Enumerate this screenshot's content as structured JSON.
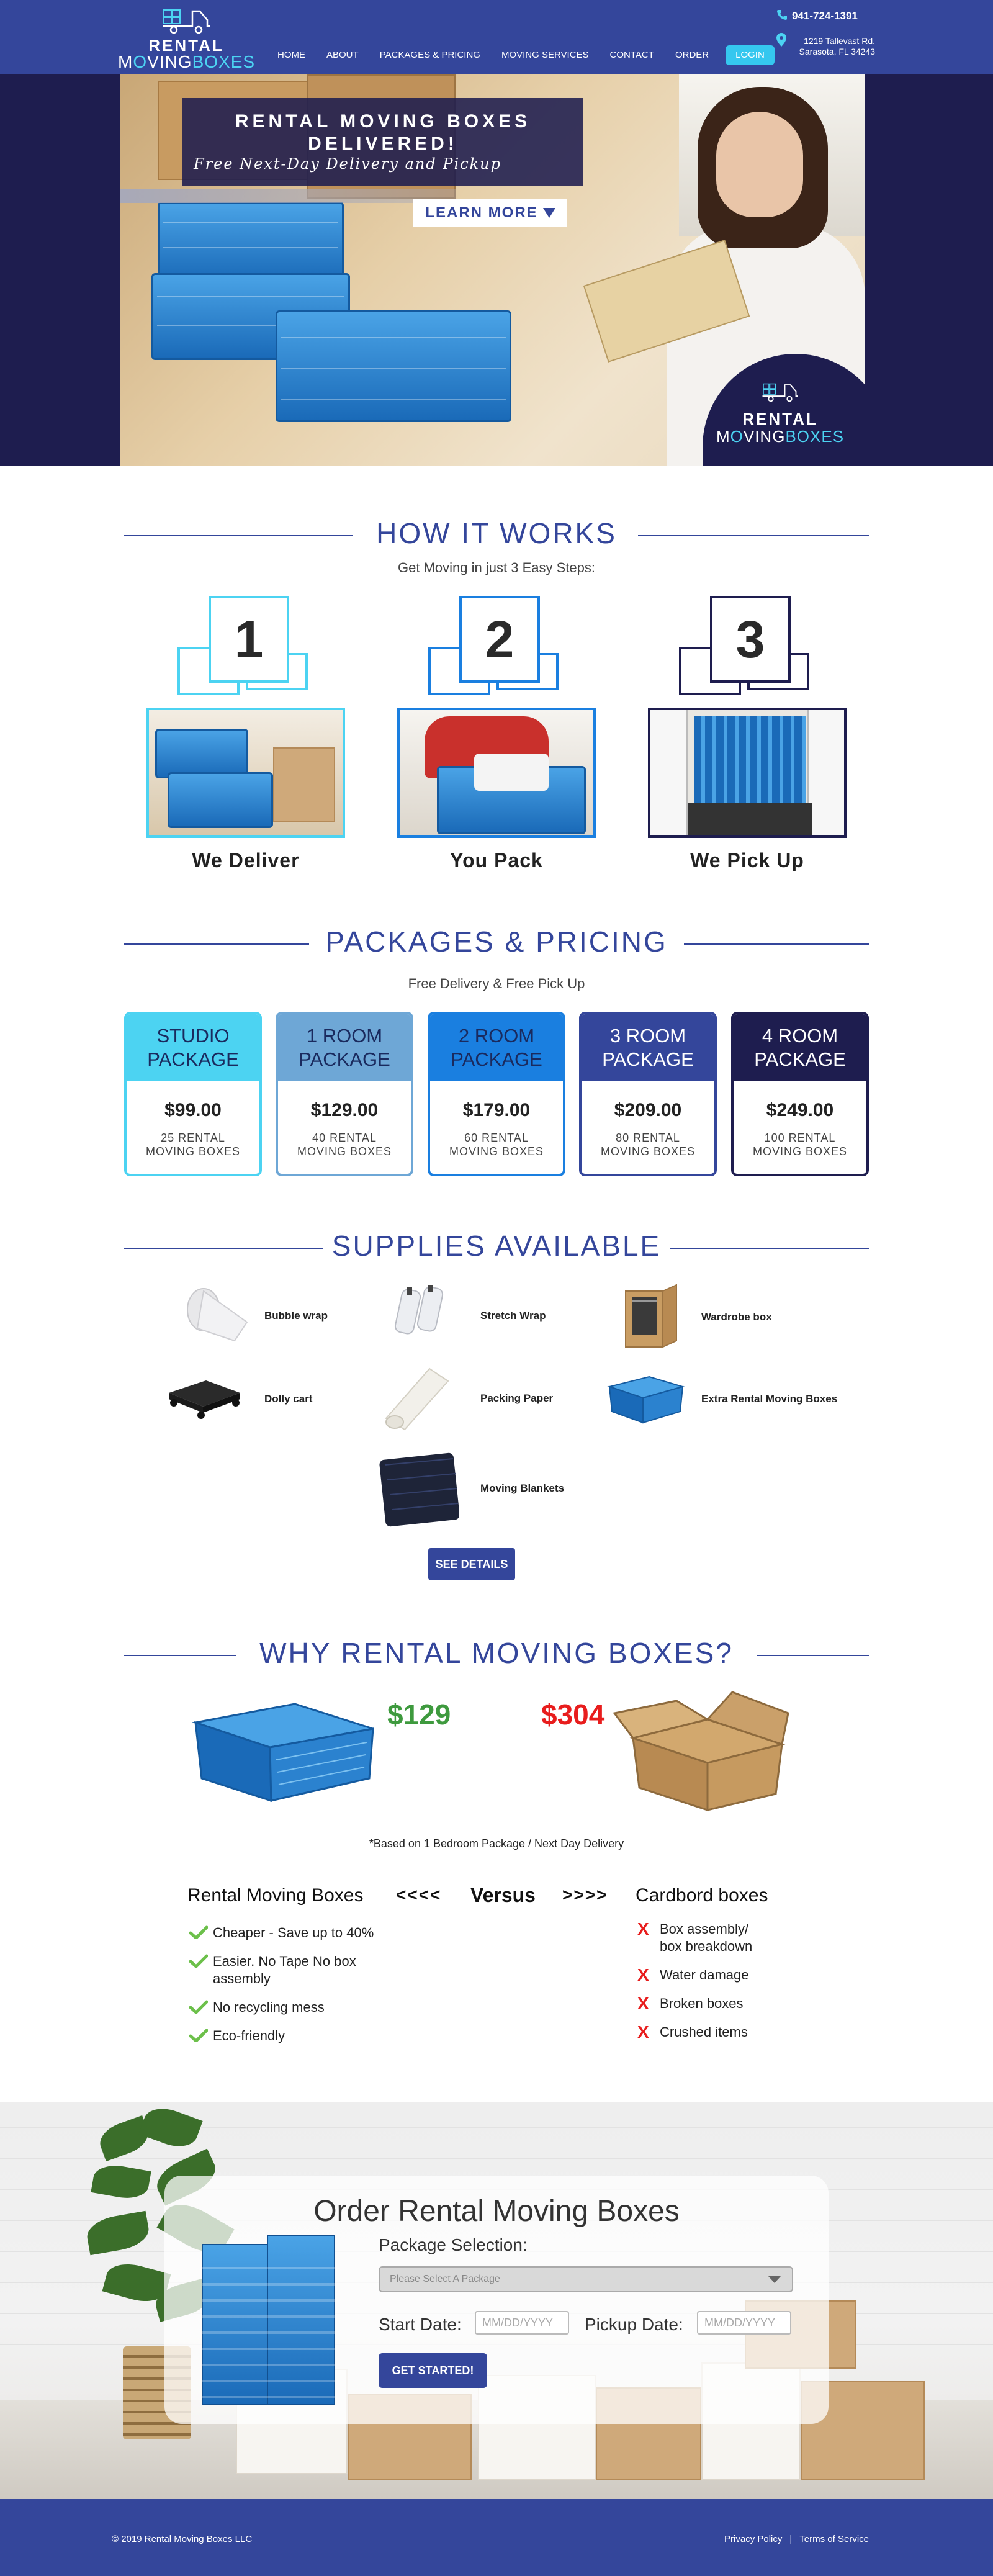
{
  "header": {
    "logo_line1": "RENTAL",
    "logo_line2_a": "M",
    "logo_line2_o": "O",
    "logo_line2_b": "VING",
    "logo_line2_c": "B",
    "logo_line2_o2": "O",
    "logo_line2_d": "XES",
    "nav": [
      "HOME",
      "ABOUT",
      "PACKAGES & PRICING",
      "MOVING SERVICES",
      "CONTACT",
      "ORDER"
    ],
    "login": "LOGIN",
    "phone": "941-724-1391",
    "address_line1": "1219 Tallevast Rd.",
    "address_line2": "Sarasota, FL 34243"
  },
  "hero": {
    "title_line1": "RENTAL MOVING BOXES",
    "title_line2": "DELIVERED!",
    "subtitle": "Free Next-Day Delivery and Pickup",
    "learn_more": "LEARN MORE",
    "badge_line1": "RENTAL",
    "badge_line2_a": "M",
    "badge_line2_o": "O",
    "badge_line2_b": "VING",
    "badge_line2_c": "B",
    "badge_line2_o2": "O",
    "badge_line2_d": "XES"
  },
  "how": {
    "title": "HOW IT WORKS",
    "subtitle": "Get Moving in just 3 Easy Steps:",
    "steps": [
      {
        "num": "1",
        "label": "We Deliver",
        "color": "#4cd3f2"
      },
      {
        "num": "2",
        "label": "You Pack",
        "color": "#1a7fe0"
      },
      {
        "num": "3",
        "label": "We Pick Up",
        "color": "#1e1d4f"
      }
    ]
  },
  "packages": {
    "title": "PACKAGES & PRICING",
    "subtitle": "Free Delivery & Free Pick Up",
    "items": [
      {
        "line1": "STUDIO",
        "line2": "PACKAGE",
        "price": "$99.00",
        "desc1": "25 RENTAL",
        "desc2": "MOVING BOXES",
        "color": "#4cd3f2",
        "text": "#1a2a5e"
      },
      {
        "line1": "1 ROOM",
        "line2": "PACKAGE",
        "price": "$129.00",
        "desc1": "40 RENTAL",
        "desc2": "MOVING BOXES",
        "color": "#6ea7d6",
        "text": "#1a2a5e"
      },
      {
        "line1": "2 ROOM",
        "line2": "PACKAGE",
        "price": "$179.00",
        "desc1": "60 RENTAL",
        "desc2": "MOVING BOXES",
        "color": "#1a7fe0",
        "text": "#1a2a5e"
      },
      {
        "line1": "3 ROOM",
        "line2": "PACKAGE",
        "price": "$209.00",
        "desc1": "80 RENTAL",
        "desc2": "MOVING BOXES",
        "color": "#34469b",
        "text": "#ffffff"
      },
      {
        "line1": "4 ROOM",
        "line2": "PACKAGE",
        "price": "$249.00",
        "desc1": "100 RENTAL",
        "desc2": "MOVING BOXES",
        "color": "#1e1d4f",
        "text": "#ffffff"
      }
    ]
  },
  "supplies": {
    "title": "SUPPLIES AVAILABLE",
    "items": [
      "Bubble wrap",
      "Stretch Wrap",
      "Wardrobe box",
      "Dolly cart",
      "Packing Paper",
      "Extra Rental Moving Boxes",
      "Moving Blankets"
    ],
    "button": "SEE DETAILS"
  },
  "why": {
    "title": "WHY RENTAL MOVING BOXES?",
    "price_rental": "$129",
    "price_cardboard": "$304",
    "note": "*Based on 1 Bedroom Package / Next Day Delivery",
    "left_title": "Rental Moving Boxes",
    "arrows_left": "<<<<",
    "versus": "Versus",
    "arrows_right": ">>>>",
    "right_title": "Cardbord boxes",
    "pros": [
      "Cheaper - Save up to 40%",
      "Easier. No Tape No box assembly",
      "No recycling mess",
      "Eco-friendly"
    ],
    "cons": [
      "Box assembly/ box breakdown",
      "Water damage",
      "Broken boxes",
      "Crushed items"
    ]
  },
  "order": {
    "title": "Order Rental Moving Boxes",
    "package_label": "Package Selection:",
    "package_placeholder": "Please Select A Package",
    "start_label": "Start Date:",
    "pickup_label": "Pickup Date:",
    "date_placeholder": "MM/DD/YYYY",
    "button": "GET STARTED!"
  },
  "footer": {
    "copyright": "© 2019 Rental Moving Boxes LLC",
    "privacy": "Privacy Policy",
    "separator": "|",
    "terms": "Terms of Service"
  }
}
